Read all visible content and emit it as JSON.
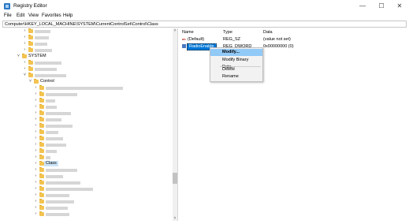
{
  "window": {
    "title": "Registry Editor",
    "controls": {
      "minimize": "—",
      "maximize": "☐",
      "close": "✕"
    }
  },
  "menu": [
    "File",
    "Edit",
    "View",
    "Favorites",
    "Help"
  ],
  "address": "Computer\\HKEY_LOCAL_MACHINE\\SYSTEM\\CurrentControlSet\\Control\\Class",
  "tree": {
    "system_label": "SYSTEM",
    "control_label": "Control",
    "class_label": "Class"
  },
  "list": {
    "headers": {
      "name": "Name",
      "type": "Type",
      "data": "Data"
    },
    "rows": [
      {
        "name": "(Default)",
        "type": "REG_SZ",
        "data": "(value not set)"
      },
      {
        "name": "RadioEnable",
        "type": "REG_DWORD",
        "data": "0x00000000 (0)"
      }
    ]
  },
  "context_menu": {
    "items": [
      "Modify...",
      "Modify Binary Data...",
      "Delete",
      "Rename"
    ]
  },
  "colors": {
    "selection": "#0078d7",
    "menu_highlight": "#91c9f7",
    "folder": "#f3c350"
  }
}
